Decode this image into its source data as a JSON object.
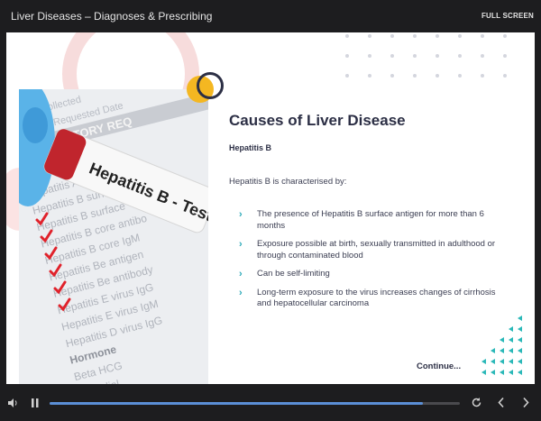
{
  "header": {
    "course_title": "Liver Diseases – Diagnoses & Prescribing",
    "fullscreen_label": "FULL SCREEN"
  },
  "slide": {
    "title": "Causes of Liver Disease",
    "subtitle": "Hepatitis B",
    "intro": "Hepatitis B is characterised by:",
    "bullets": [
      "The presence of Hepatitis B surface antigen for more than 6 months",
      "Exposure possible at birth, sexually transmitted in adulthood or through contaminated blood",
      "Can be self-limiting",
      "Long-term exposure to the virus increases changes of cirrhosis and hepatocellular carcinoma"
    ],
    "continue_label": "Continue...",
    "image": {
      "tube_label": "Hepatitis B - Test",
      "form_header": [
        "Collected",
        "Requested Date",
        "RATORY REQ"
      ],
      "form_lines": [
        "Hepatitis A",
        "Hepatitis A vi",
        "Hepatitis B surfa",
        "Hepatitis B surface",
        "Hepatitis B core antibo",
        "Hepatitis B core IgM",
        "Hepatitis Be antigen",
        "Hepatitis Be antibody",
        "Hepatitis E virus IgG",
        "Hepatitis E virus IgM",
        "Hepatitis D virus IgG",
        "Hormone",
        "Beta HCG",
        "Estradiol"
      ]
    }
  },
  "player": {
    "progress": 0.91
  },
  "colors": {
    "accent": "#2aa8b8",
    "navy": "#2c2f45",
    "yellow": "#f4b721",
    "progress": "#5b8fd6"
  }
}
